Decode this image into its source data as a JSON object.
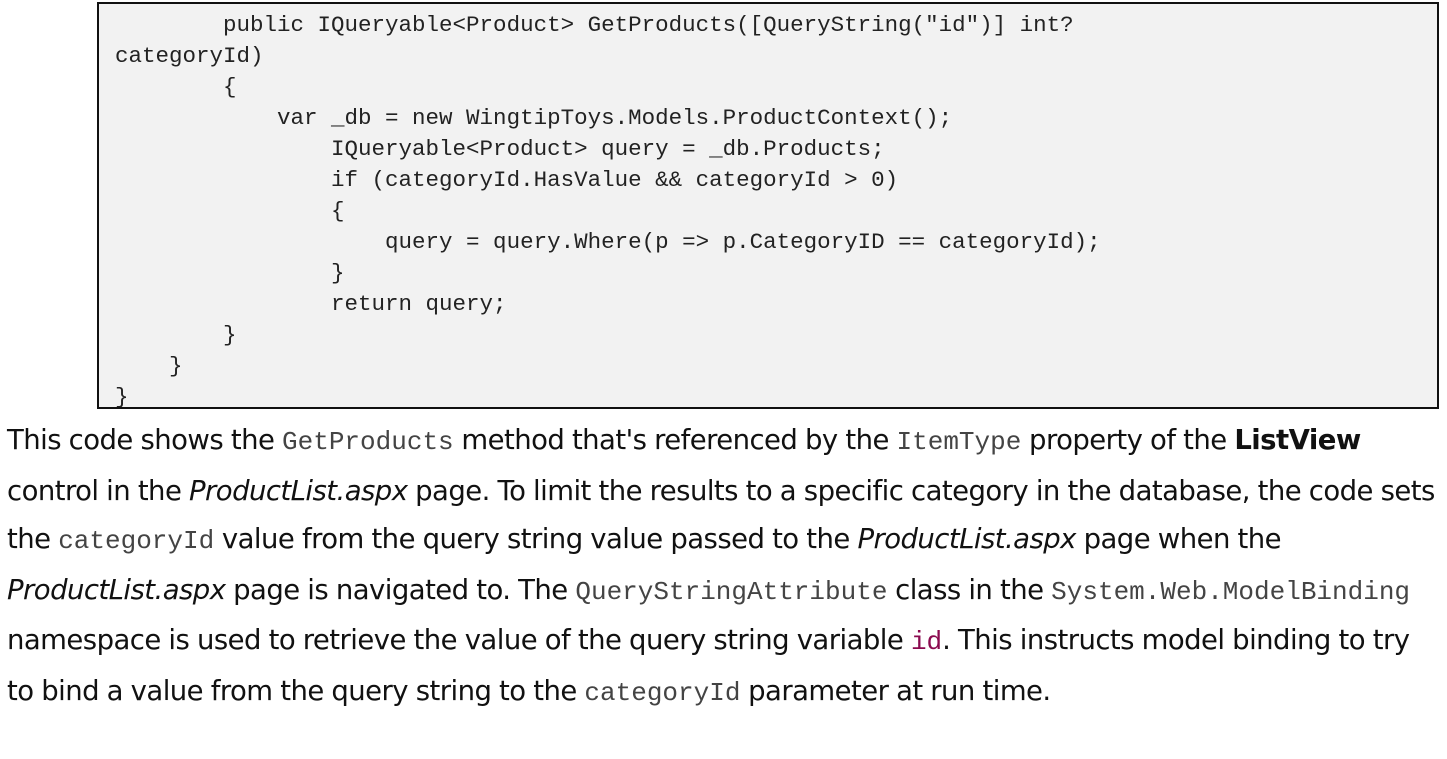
{
  "code_block": {
    "lines": [
      "        public IQueryable<Product> GetProducts([QueryString(\"id\")] int?",
      "categoryId)",
      "        {",
      "            var _db = new WingtipToys.Models.ProductContext();",
      "                IQueryable<Product> query = _db.Products;",
      "                if (categoryId.HasValue && categoryId > 0)",
      "                {",
      "                    query = query.Where(p => p.CategoryID == categoryId);",
      "                }",
      "                return query;",
      "        }",
      "    }",
      "}"
    ]
  },
  "paragraph": {
    "t1": "This code shows the ",
    "c1": "GetProducts",
    "t2": " method that's referenced by the ",
    "c2": "ItemType",
    "t3": " property of the ",
    "b1": "ListView",
    "t4": " control in the ",
    "i1": "ProductList.aspx",
    "t5": " page. To limit the results to a specific category in the database, the code sets the ",
    "c3": "categoryId",
    "t6": " value from the query string value passed to the ",
    "i2": "ProductList.aspx",
    "t7": " page when the ",
    "i3": "ProductList.aspx",
    "t8": " page is navigated to. The ",
    "c4": "QueryStringAttribute",
    "t9": " class in the ",
    "c5": "System.Web.ModelBinding",
    "t10": " namespace is used to retrieve the value of the query string variable ",
    "c6": "id",
    "t11": ". This instructs model binding to try to bind a value from the query string to the ",
    "c7": "categoryId",
    "t12": " parameter at run time."
  }
}
